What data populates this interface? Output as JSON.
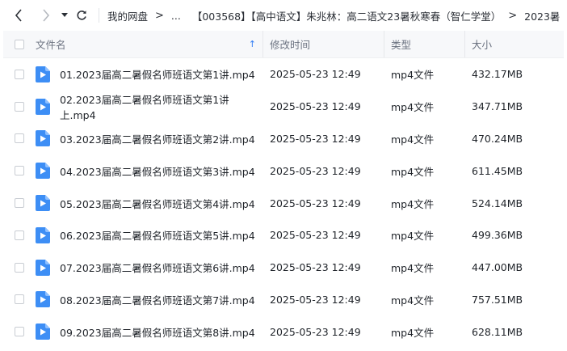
{
  "toolbar": {
    "back_icon": "chevron-left-icon",
    "forward_icon": "chevron-right-icon",
    "dropdown_icon": "caret-down-icon",
    "refresh_icon": "refresh-icon",
    "breadcrumbs": [
      "我的网盘",
      "...",
      "【003568】【高中语文】朱兆林：高二语文23暑秋寒春（智仁学堂）",
      "2023暑"
    ],
    "separator": ">"
  },
  "table": {
    "columns": {
      "name": "文件名",
      "modified": "修改时间",
      "type": "类型",
      "size": "大小"
    },
    "sort_indicator": "↑",
    "rows": [
      {
        "name": "01.2023届高二暑假名师班语文第1讲.mp4",
        "modified": "2025-05-23 12:49",
        "type": "mp4文件",
        "size": "432.17MB"
      },
      {
        "name": "02.2023届高二暑假名师班语文第1讲上.mp4",
        "modified": "2025-05-23 12:49",
        "type": "mp4文件",
        "size": "347.71MB"
      },
      {
        "name": "03.2023届高二暑假名师班语文第2讲.mp4",
        "modified": "2025-05-23 12:49",
        "type": "mp4文件",
        "size": "470.24MB"
      },
      {
        "name": "04.2023届高二暑假名师班语文第3讲.mp4",
        "modified": "2025-05-23 12:49",
        "type": "mp4文件",
        "size": "611.45MB"
      },
      {
        "name": "05.2023届高二暑假名师班语文第4讲.mp4",
        "modified": "2025-05-23 12:49",
        "type": "mp4文件",
        "size": "524.14MB"
      },
      {
        "name": "06.2023届高二暑假名师班语文第5讲.mp4",
        "modified": "2025-05-23 12:49",
        "type": "mp4文件",
        "size": "499.36MB"
      },
      {
        "name": "07.2023届高二暑假名师班语文第6讲.mp4",
        "modified": "2025-05-23 12:49",
        "type": "mp4文件",
        "size": "447.00MB"
      },
      {
        "name": "08.2023届高二暑假名师班语文第7讲.mp4",
        "modified": "2025-05-23 12:49",
        "type": "mp4文件",
        "size": "757.51MB"
      },
      {
        "name": "09.2023届高二暑假名师班语文第8讲.mp4",
        "modified": "2025-05-23 12:49",
        "type": "mp4文件",
        "size": "628.11MB"
      }
    ]
  },
  "colors": {
    "accent": "#2f7cf6",
    "video_icon": "#3d8ef5"
  },
  "file_icon": "video-file-icon"
}
